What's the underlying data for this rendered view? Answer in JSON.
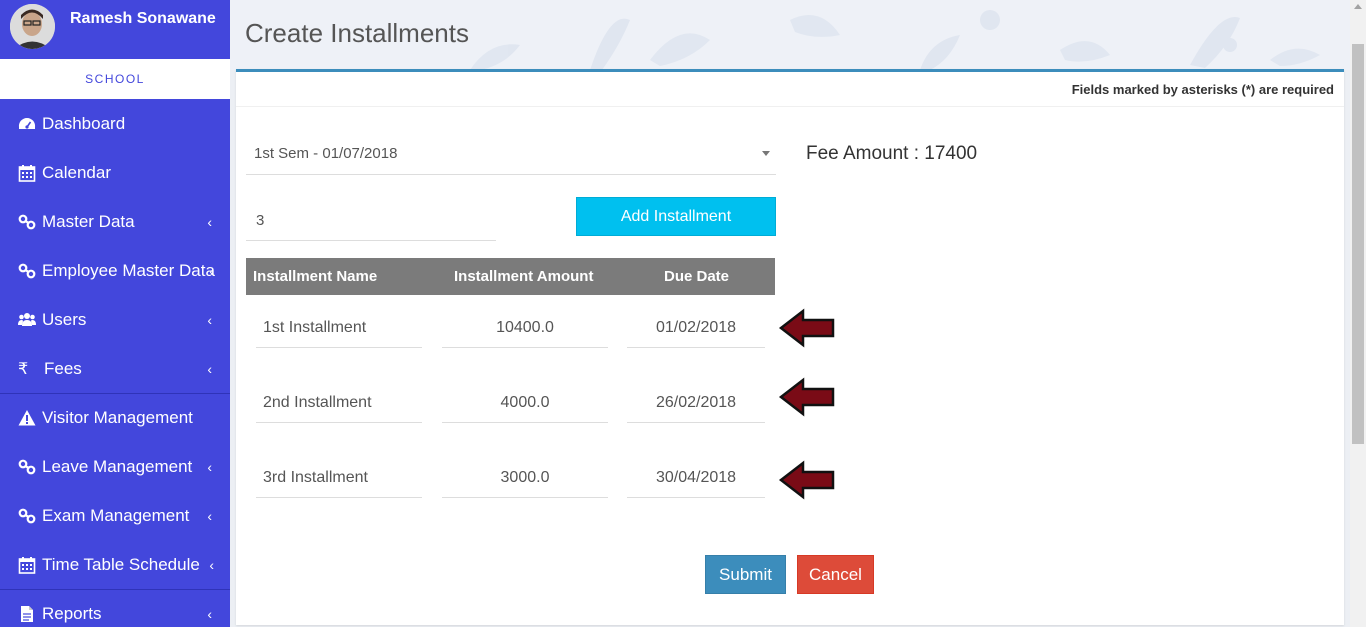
{
  "user": {
    "name": "Ramesh Sonawane",
    "role": "SCHOOL"
  },
  "sidebar": {
    "items": [
      {
        "label": "Dashboard",
        "icon": "dashboard-icon",
        "has_children": false
      },
      {
        "label": "Calendar",
        "icon": "calendar-icon",
        "has_children": false
      },
      {
        "label": "Master Data",
        "icon": "link-icon",
        "has_children": true
      },
      {
        "label": "Employee Master Data",
        "icon": "link-icon",
        "has_children": true
      },
      {
        "label": "Users",
        "icon": "users-icon",
        "has_children": true
      },
      {
        "label": "Fees",
        "icon": "rupee-icon",
        "has_children": true
      },
      {
        "label": "Visitor Management",
        "icon": "warning-icon",
        "has_children": false
      },
      {
        "label": "Leave Management",
        "icon": "link-icon",
        "has_children": true
      },
      {
        "label": "Exam Management",
        "icon": "link-icon",
        "has_children": true
      },
      {
        "label": "Time Table Schedule",
        "icon": "calendar-icon",
        "has_children": true
      },
      {
        "label": "Reports",
        "icon": "file-icon",
        "has_children": true
      }
    ],
    "chevron": "‹",
    "rupee_glyph": "₹"
  },
  "page": {
    "title": "Create Installments",
    "required_note": "Fields marked by asterisks (*) are required"
  },
  "form": {
    "semester_selected": "1st Sem - 01/07/2018",
    "fee_amount_label": "Fee Amount : 17400",
    "installment_count": "3",
    "add_button": "Add Installment",
    "table_headers": [
      "Installment Name",
      "Installment Amount",
      "Due Date"
    ],
    "rows": [
      {
        "name": "1st Installment",
        "amount": "10400.0",
        "due_date": "01/02/2018"
      },
      {
        "name": "2nd Installment",
        "amount": "4000.0",
        "due_date": "26/02/2018"
      },
      {
        "name": "3rd Installment",
        "amount": "3000.0",
        "due_date": "30/04/2018"
      }
    ],
    "submit_button": "Submit",
    "cancel_button": "Cancel"
  },
  "colors": {
    "sidebar": "#4347dc",
    "primary": "#3c8dbc",
    "info": "#00c0ef",
    "danger": "#dd4b39",
    "arrow": "#7a0b16"
  }
}
